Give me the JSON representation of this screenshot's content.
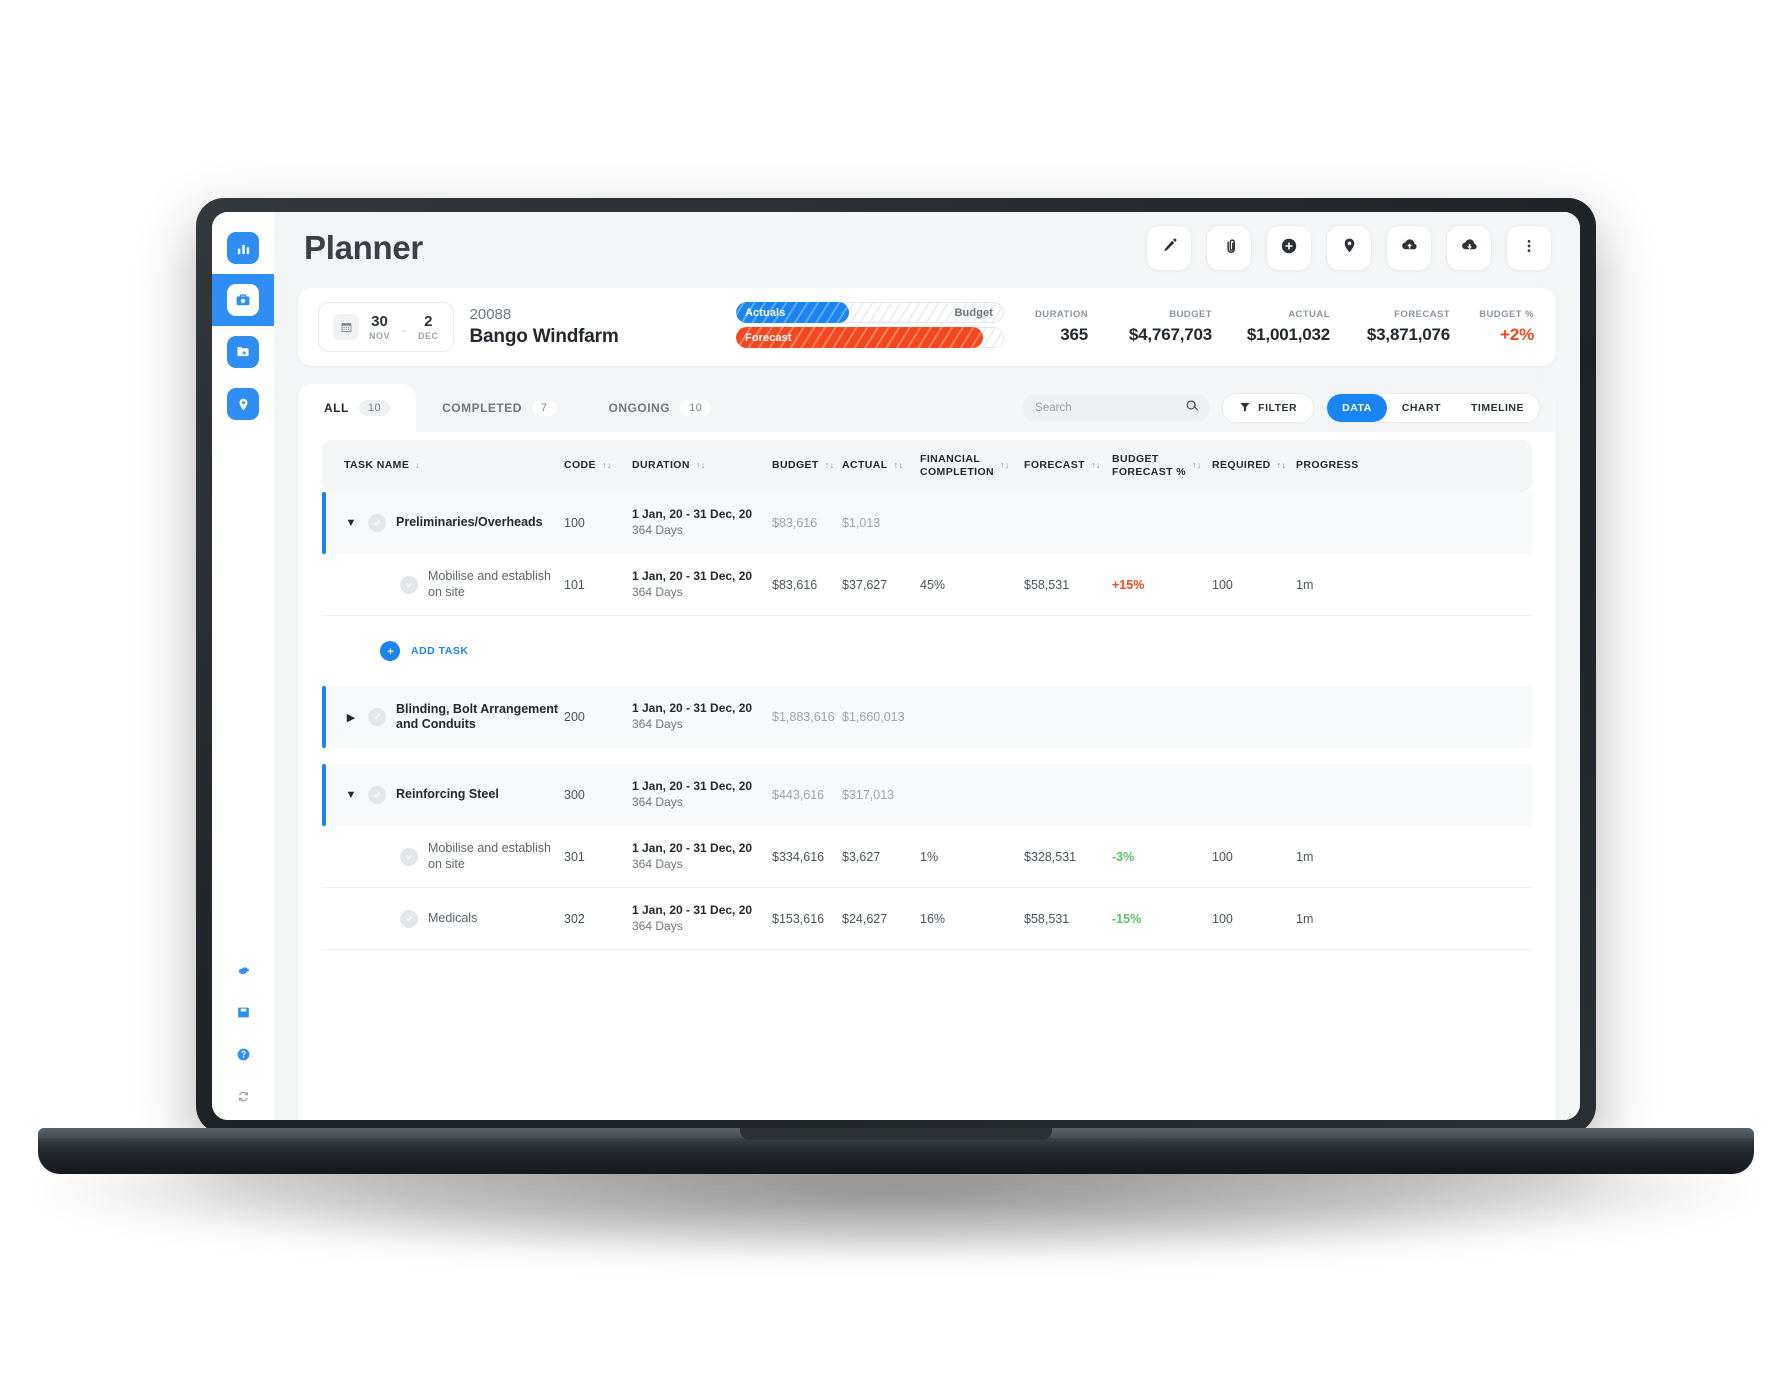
{
  "app": {
    "title": "Planner",
    "accent": "#1a84f2",
    "danger": "#f4471e",
    "success": "#5ec26a"
  },
  "sidebar": {
    "items": [
      {
        "name": "analytics",
        "icon": "bar-chart-icon",
        "active": false
      },
      {
        "name": "projects",
        "icon": "briefcase-icon",
        "active": true
      },
      {
        "name": "documents",
        "icon": "folder-plus-icon",
        "active": false
      },
      {
        "name": "locations",
        "icon": "map-pin-icon",
        "active": false
      }
    ],
    "bottom_items": [
      {
        "name": "settings",
        "icon": "gear-icon"
      },
      {
        "name": "archive",
        "icon": "save-box-icon"
      },
      {
        "name": "help",
        "icon": "question-circle-icon"
      },
      {
        "name": "sync",
        "icon": "sync-icon"
      }
    ]
  },
  "topbar": {
    "actions": [
      {
        "name": "edit-button",
        "icon": "pencil-icon"
      },
      {
        "name": "attach-button",
        "icon": "paperclip-icon"
      },
      {
        "name": "add-button",
        "icon": "plus-circle-icon"
      },
      {
        "name": "location-button",
        "icon": "map-pin-icon"
      },
      {
        "name": "upload-button",
        "icon": "cloud-upload-icon"
      },
      {
        "name": "download-button",
        "icon": "cloud-download-icon"
      },
      {
        "name": "more-button",
        "icon": "three-dots-vertical-icon"
      }
    ]
  },
  "summary": {
    "date_range": {
      "start_day": "30",
      "start_month": "NOV",
      "separator": "-",
      "end_day": "2",
      "end_month": "DEC"
    },
    "project_id": "20088",
    "project_name": "Bango Windfarm",
    "bars": {
      "actuals_label": "Actuals",
      "budget_label": "Budget",
      "forecast_label": "Forecast",
      "actuals_percent": 42,
      "forecast_percent": 92
    },
    "metrics": [
      {
        "key": "DURATION",
        "value": "365",
        "tone": "normal"
      },
      {
        "key": "BUDGET",
        "value": "$4,767,703",
        "tone": "normal"
      },
      {
        "key": "ACTUAL",
        "value": "$1,001,032",
        "tone": "normal"
      },
      {
        "key": "FORECAST",
        "value": "$3,871,076",
        "tone": "normal"
      },
      {
        "key": "BUDGET %",
        "value": "+2%",
        "tone": "positive"
      }
    ]
  },
  "tabs": [
    {
      "label": "ALL",
      "count": "10",
      "active": true
    },
    {
      "label": "COMPLETED",
      "count": "7",
      "active": false
    },
    {
      "label": "ONGOING",
      "count": "10",
      "active": false
    }
  ],
  "toolbar": {
    "search_placeholder": "Search",
    "search_value": "",
    "filter_label": "FILTER",
    "views": [
      {
        "label": "DATA",
        "active": true
      },
      {
        "label": "CHART",
        "active": false
      },
      {
        "label": "TIMELINE",
        "active": false
      }
    ]
  },
  "table": {
    "columns": [
      {
        "label": "TASK NAME",
        "sort": "down"
      },
      {
        "label": "CODE",
        "sort": "both"
      },
      {
        "label": "DURATION",
        "sort": "both"
      },
      {
        "label": "BUDGET",
        "sort": "both"
      },
      {
        "label": "ACTUAL",
        "sort": "both"
      },
      {
        "label": "FINANCIAL COMPLETION",
        "sort": "both"
      },
      {
        "label": "FORECAST",
        "sort": "both"
      },
      {
        "label": "BUDGET FORECAST %",
        "sort": "both"
      },
      {
        "label": "REQUIRED",
        "sort": "both"
      },
      {
        "label": "PROGRESS",
        "sort": "none"
      }
    ],
    "add_task_label": "ADD TASK",
    "rows": [
      {
        "type": "group",
        "expanded": true,
        "name": "Preliminaries/Overheads",
        "code": "100",
        "duration_range": "1 Jan, 20 - 31 Dec, 20",
        "duration_days": "364 Days",
        "budget": "$83,616",
        "actual": "$1,013",
        "financial_completion": "",
        "forecast": "",
        "budget_forecast_pct": "",
        "budget_forecast_tone": "none",
        "required": "",
        "progress": ""
      },
      {
        "type": "child",
        "name": "Mobilise and establish on site",
        "code": "101",
        "duration_range": "1 Jan, 20 - 31 Dec, 20",
        "duration_days": "364 Days",
        "budget": "$83,616",
        "actual": "$37,627",
        "financial_completion": "45%",
        "forecast": "$58,531",
        "budget_forecast_pct": "+15%",
        "budget_forecast_tone": "positive",
        "required": "100",
        "progress": "1m"
      },
      {
        "type": "add-task"
      },
      {
        "type": "group",
        "expanded": false,
        "name": "Blinding, Bolt Arrangement and Conduits",
        "code": "200",
        "duration_range": "1 Jan, 20 - 31 Dec, 20",
        "duration_days": "364 Days",
        "budget": "$1,883,616",
        "actual": "$1,660,013",
        "financial_completion": "",
        "forecast": "",
        "budget_forecast_pct": "",
        "budget_forecast_tone": "none",
        "required": "",
        "progress": ""
      },
      {
        "type": "group",
        "expanded": true,
        "name": "Reinforcing Steel",
        "code": "300",
        "duration_range": "1 Jan, 20 - 31 Dec, 20",
        "duration_days": "364 Days",
        "budget": "$443,616",
        "actual": "$317,013",
        "financial_completion": "",
        "forecast": "",
        "budget_forecast_pct": "",
        "budget_forecast_tone": "none",
        "required": "",
        "progress": ""
      },
      {
        "type": "child",
        "name": "Mobilise and establish on site",
        "code": "301",
        "duration_range": "1 Jan, 20 - 31 Dec, 20",
        "duration_days": "364 Days",
        "budget": "$334,616",
        "actual": "$3,627",
        "financial_completion": "1%",
        "forecast": "$328,531",
        "budget_forecast_pct": "-3%",
        "budget_forecast_tone": "negative",
        "required": "100",
        "progress": "1m"
      },
      {
        "type": "child",
        "name": "Medicals",
        "code": "302",
        "duration_range": "1 Jan, 20 - 31 Dec, 20",
        "duration_days": "364 Days",
        "budget": "$153,616",
        "actual": "$24,627",
        "financial_completion": "16%",
        "forecast": "$58,531",
        "budget_forecast_pct": "-15%",
        "budget_forecast_tone": "negative",
        "required": "100",
        "progress": "1m"
      }
    ]
  }
}
